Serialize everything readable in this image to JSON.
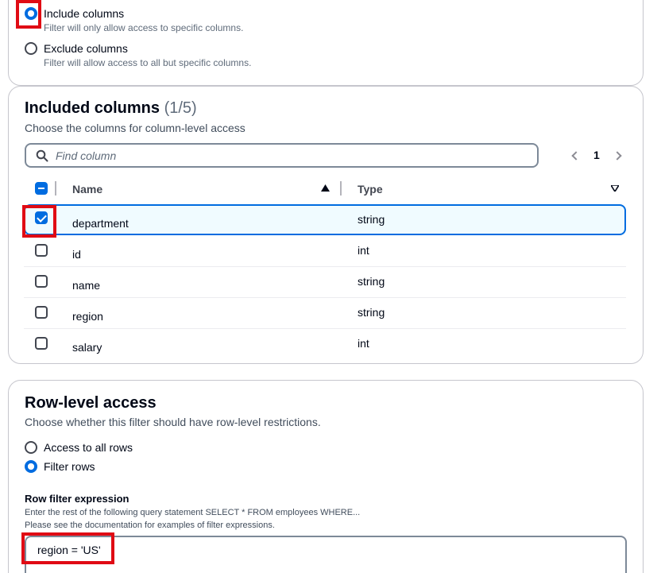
{
  "column_filter": {
    "options": [
      {
        "label": "Include columns",
        "desc": "Filter will only allow access to specific columns.",
        "selected": true
      },
      {
        "label": "Exclude columns",
        "desc": "Filter will allow access to all but specific columns.",
        "selected": false
      }
    ]
  },
  "included_columns": {
    "title": "Included columns",
    "count": "(1/5)",
    "subtitle": "Choose the columns for column-level access",
    "search_placeholder": "Find column",
    "page_number": "1",
    "headers": {
      "name": "Name",
      "type": "Type"
    },
    "rows": [
      {
        "name": "department",
        "type": "string",
        "checked": true
      },
      {
        "name": "id",
        "type": "int",
        "checked": false
      },
      {
        "name": "name",
        "type": "string",
        "checked": false
      },
      {
        "name": "region",
        "type": "string",
        "checked": false
      },
      {
        "name": "salary",
        "type": "int",
        "checked": false
      }
    ]
  },
  "row_level": {
    "title": "Row-level access",
    "subtitle": "Choose whether this filter should have row-level restrictions.",
    "options": [
      {
        "label": "Access to all rows",
        "selected": false
      },
      {
        "label": "Filter rows",
        "selected": true
      }
    ],
    "expression": {
      "label": "Row filter expression",
      "desc_line1": "Enter the rest of the following query statement SELECT * FROM employees WHERE...",
      "desc_line2": "Please see the documentation for examples of filter expressions.",
      "value": "region = 'US'"
    }
  },
  "icons": {
    "search": "search-icon",
    "sort_asc": "caret-up-icon",
    "sort_desc": "caret-down-icon",
    "prev": "chevron-left-icon",
    "next": "chevron-right-icon"
  },
  "colors": {
    "accent": "#006ce0",
    "highlight": "#e00b14",
    "border": "#c6c6cd"
  }
}
